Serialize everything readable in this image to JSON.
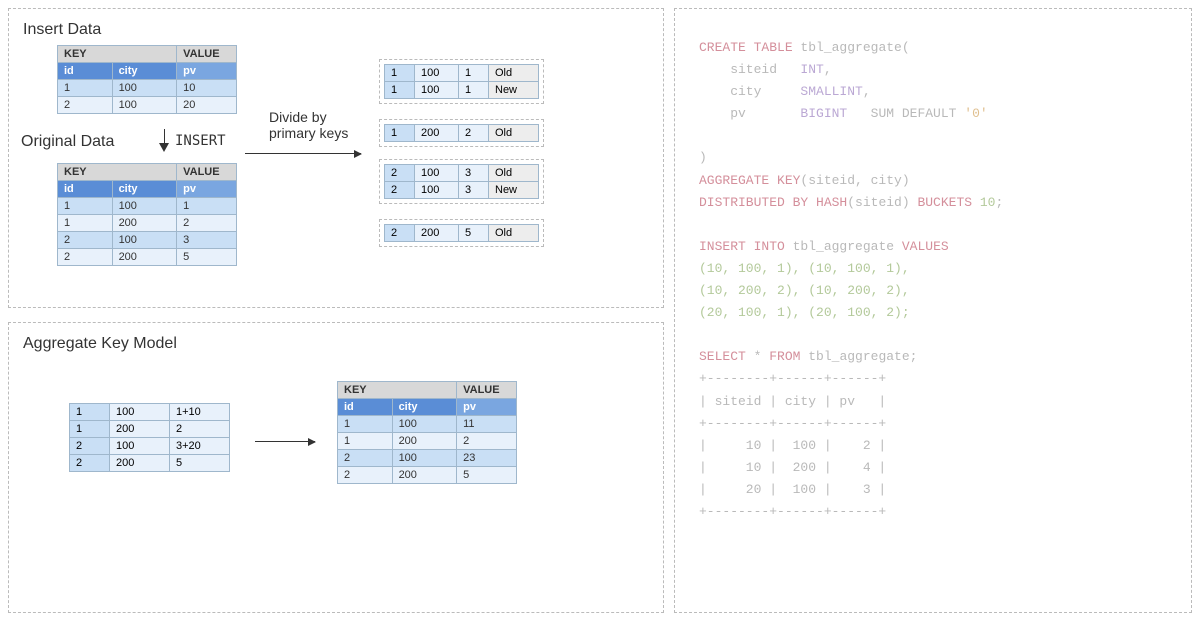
{
  "top": {
    "title_insert": "Insert Data",
    "title_original": "Original Data",
    "insert_label": "INSERT",
    "divide_label1": "Divide by",
    "divide_label2": "primary keys",
    "headers": {
      "key": "KEY",
      "value": "VALUE",
      "id": "id",
      "city": "city",
      "pv": "pv"
    },
    "insert_rows": [
      {
        "id": "1",
        "city": "100",
        "pv": "10"
      },
      {
        "id": "2",
        "city": "100",
        "pv": "20"
      }
    ],
    "original_rows": [
      {
        "id": "1",
        "city": "100",
        "pv": "1"
      },
      {
        "id": "1",
        "city": "200",
        "pv": "2"
      },
      {
        "id": "2",
        "city": "100",
        "pv": "3"
      },
      {
        "id": "2",
        "city": "200",
        "pv": "5"
      }
    ],
    "mini": {
      "g1": [
        {
          "a": "1",
          "b": "100",
          "c": "1",
          "tag": "Old"
        },
        {
          "a": "1",
          "b": "100",
          "c": "1",
          "tag": "New"
        }
      ],
      "g2": [
        {
          "a": "1",
          "b": "200",
          "c": "2",
          "tag": "Old"
        }
      ],
      "g3": [
        {
          "a": "2",
          "b": "100",
          "c": "3",
          "tag": "Old"
        },
        {
          "a": "2",
          "b": "100",
          "c": "3",
          "tag": "New"
        }
      ],
      "g4": [
        {
          "a": "2",
          "b": "200",
          "c": "5",
          "tag": "Old"
        }
      ]
    }
  },
  "bottom": {
    "title": "Aggregate Key Model",
    "left_rows": [
      {
        "a": "1",
        "b": "100",
        "c": "1+10"
      },
      {
        "a": "1",
        "b": "200",
        "c": "2"
      },
      {
        "a": "2",
        "b": "100",
        "c": "3+20"
      },
      {
        "a": "2",
        "b": "200",
        "c": "5"
      }
    ],
    "right_rows": [
      {
        "id": "1",
        "city": "100",
        "pv": "11"
      },
      {
        "id": "1",
        "city": "200",
        "pv": "2"
      },
      {
        "id": "2",
        "city": "100",
        "pv": "23"
      },
      {
        "id": "2",
        "city": "200",
        "pv": "5"
      }
    ]
  },
  "code": {
    "l1a": "CREATE TABLE",
    "l1b": " tbl_aggregate(",
    "l2a": "    siteid   ",
    "l2b": "INT",
    "l2c": ",",
    "l3a": "    city     ",
    "l3b": "SMALLINT",
    "l3c": ",",
    "l4a": "    pv       ",
    "l4b": "BIGINT",
    "l4c": "   SUM DEFAULT ",
    "l4d": "'0'",
    "l5": "",
    "l6": ")",
    "l7a": "AGGREGATE KEY",
    "l7b": "(siteid, city)",
    "l8a": "DISTRIBUTED BY HASH",
    "l8b": "(siteid) ",
    "l8c": "BUCKETS",
    "l8d": " 10",
    "l8e": ";",
    "l9": "",
    "l10a": "INSERT INTO",
    "l10b": " tbl_aggregate ",
    "l10c": "VALUES",
    "l11": "(10, 100, 1), (10, 100, 1),",
    "l12": "(10, 200, 2), (10, 200, 2),",
    "l13": "(20, 100, 1), (20, 100, 2);",
    "l14": "",
    "l15a": "SELECT",
    "l15b": " * ",
    "l15c": "FROM",
    "l15d": " tbl_aggregate;",
    "l16": "+--------+------+------+",
    "l17": "| siteid | city | pv   |",
    "l18": "+--------+------+------+",
    "l19": "|     10 |  100 |    2 |",
    "l20": "|     10 |  200 |    4 |",
    "l21": "|     20 |  100 |    3 |",
    "l22": "+--------+------+------+"
  }
}
